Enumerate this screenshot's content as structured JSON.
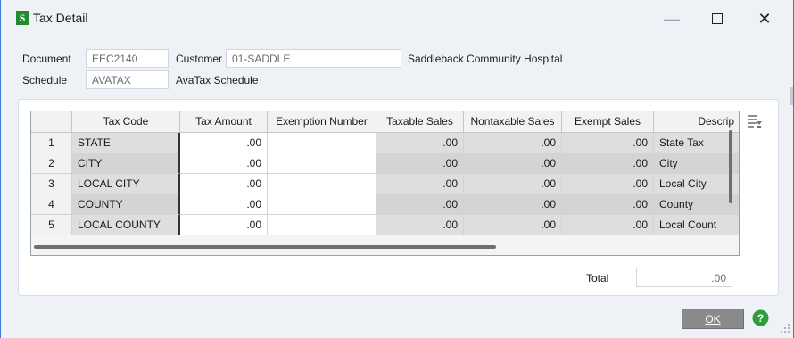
{
  "window": {
    "title": "Tax Detail",
    "app_icon_letter": "S",
    "minimize": "—",
    "close": "✕"
  },
  "form": {
    "document_label": "Document",
    "document_value": "EEC2140",
    "customer_label": "Customer",
    "customer_value": "01-SADDLE",
    "customer_name": "Saddleback Community Hospital",
    "schedule_label": "Schedule",
    "schedule_value": "AVATAX",
    "schedule_name": "AvaTax Schedule"
  },
  "grid": {
    "headers": [
      "",
      "Tax Code",
      "Tax Amount",
      "Exemption Number",
      "Taxable Sales",
      "Nontaxable Sales",
      "Exempt Sales",
      "Descrip"
    ],
    "rows": [
      {
        "num": "1",
        "code": "STATE",
        "amount": ".00",
        "exemption": "",
        "taxable": ".00",
        "nontaxable": ".00",
        "exempt": ".00",
        "desc": "State Tax"
      },
      {
        "num": "2",
        "code": "CITY",
        "amount": ".00",
        "exemption": "",
        "taxable": ".00",
        "nontaxable": ".00",
        "exempt": ".00",
        "desc": "City"
      },
      {
        "num": "3",
        "code": "LOCAL CITY",
        "amount": ".00",
        "exemption": "",
        "taxable": ".00",
        "nontaxable": ".00",
        "exempt": ".00",
        "desc": "Local City"
      },
      {
        "num": "4",
        "code": "COUNTY",
        "amount": ".00",
        "exemption": "",
        "taxable": ".00",
        "nontaxable": ".00",
        "exempt": ".00",
        "desc": "County"
      },
      {
        "num": "5",
        "code": "LOCAL COUNTY",
        "amount": ".00",
        "exemption": "",
        "taxable": ".00",
        "nontaxable": ".00",
        "exempt": ".00",
        "desc": "Local Count"
      }
    ]
  },
  "totals": {
    "label": "Total",
    "value": ".00"
  },
  "buttons": {
    "ok": "OK"
  },
  "icons": {
    "app": "sage-s-icon",
    "grid_tool": "grid-settings-icon",
    "help": "help-icon"
  },
  "colors": {
    "help_green": "#2e9d3a",
    "ok_bg": "#8a8a8a"
  }
}
